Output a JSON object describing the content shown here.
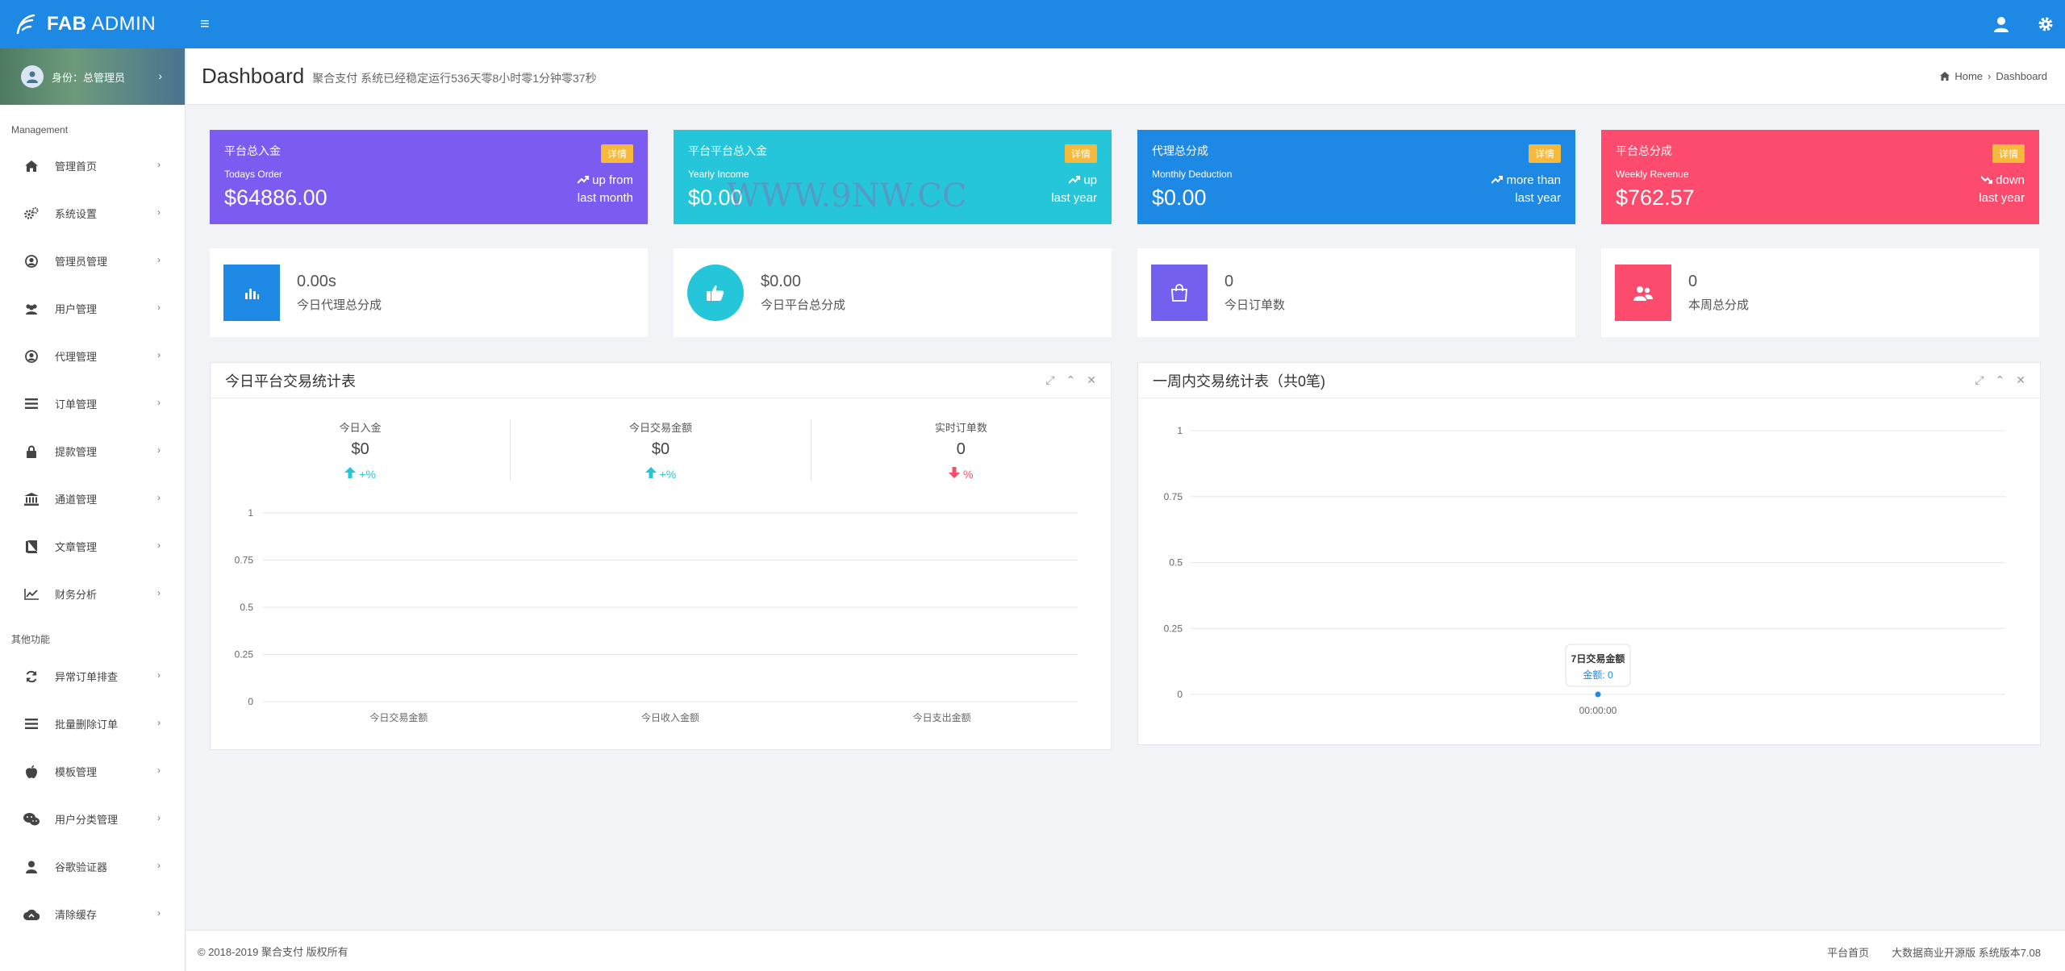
{
  "brand": {
    "name_bold": "FAB",
    "name_rest": " ADMIN"
  },
  "profile": {
    "label": "身份：总管理员"
  },
  "sidebar": {
    "section1": "Management",
    "section2": "其他功能",
    "items1": [
      {
        "label": "管理首页",
        "icon": "home-icon"
      },
      {
        "label": "系统设置",
        "icon": "gears-icon"
      },
      {
        "label": "管理员管理",
        "icon": "user-circle-icon"
      },
      {
        "label": "用户管理",
        "icon": "users-icon"
      },
      {
        "label": "代理管理",
        "icon": "user-circle-icon"
      },
      {
        "label": "订单管理",
        "icon": "list-icon"
      },
      {
        "label": "提款管理",
        "icon": "lock-icon"
      },
      {
        "label": "通道管理",
        "icon": "bank-icon"
      },
      {
        "label": "文章管理",
        "icon": "book-icon"
      },
      {
        "label": "财务分析",
        "icon": "line-chart-icon"
      }
    ],
    "items2": [
      {
        "label": "异常订单排查",
        "icon": "refresh-icon"
      },
      {
        "label": "批量删除订单",
        "icon": "list-icon"
      },
      {
        "label": "模板管理",
        "icon": "apple-icon"
      },
      {
        "label": "用户分类管理",
        "icon": "wechat-icon"
      },
      {
        "label": "谷歌验证器",
        "icon": "user-icon"
      },
      {
        "label": "清除缓存",
        "icon": "cloud-icon"
      }
    ]
  },
  "header": {
    "title": "Dashboard",
    "subtitle": "聚合支付 系统已经稳定运行536天零8小时零1分钟零37秒",
    "breadcrumb_home": "Home",
    "breadcrumb_current": "Dashboard"
  },
  "stat_cards": [
    {
      "title": "平台总入金",
      "sub": "Todays Order",
      "value": "$64886.00",
      "badge": "详情",
      "trend1": "up from",
      "trend2": "last month",
      "color": "#7c5cf0"
    },
    {
      "title": "平台平台总入金",
      "sub": "Yearly Income",
      "value": "$0.00",
      "badge": "详情",
      "trend1": "up",
      "trend2": "last year",
      "color": "#26c6da"
    },
    {
      "title": "代理总分成",
      "sub": "Monthly Deduction",
      "value": "$0.00",
      "badge": "详情",
      "trend1": "more than",
      "trend2": "last year",
      "color": "#1e88e5"
    },
    {
      "title": "平台总分成",
      "sub": "Weekly Revenue",
      "value": "$762.57",
      "badge": "详情",
      "trend1": "down",
      "trend2": "last year",
      "color": "#fc4b6c"
    }
  ],
  "info_boxes": [
    {
      "value": "0.00s",
      "label": "今日代理总分成",
      "color": "#1e88e5",
      "icon": "bar-chart-icon"
    },
    {
      "value": "$0.00",
      "label": "今日平台总分成",
      "color": "#26c6da",
      "icon": "thumbs-up-icon"
    },
    {
      "value": "0",
      "label": "今日订单数",
      "color": "#7460ee",
      "icon": "shopping-bag-icon"
    },
    {
      "value": "0",
      "label": "本周总分成",
      "color": "#fc4b6c",
      "icon": "users-icon"
    }
  ],
  "panel_today": {
    "title": "今日平台交易统计表",
    "kpis": [
      {
        "label": "今日入金",
        "value": "$0",
        "change": "+%",
        "dir": "up"
      },
      {
        "label": "今日交易金额",
        "value": "$0",
        "change": "+%",
        "dir": "up"
      },
      {
        "label": "实时订单数",
        "value": "0",
        "change": "%",
        "dir": "down"
      }
    ]
  },
  "panel_week": {
    "title": "一周内交易统计表（共0笔)"
  },
  "chart_data": [
    {
      "type": "bar",
      "categories": [
        "今日交易金额",
        "今日收入金额",
        "今日支出金额"
      ],
      "values": [
        0,
        0,
        0
      ],
      "yticks": [
        "0",
        "0.25",
        "0.5",
        "0.75",
        "1"
      ],
      "ylim": [
        0,
        1
      ]
    },
    {
      "type": "line",
      "x": [
        "00:00:00"
      ],
      "series": [
        {
          "name": "7日交易金额",
          "values": [
            0
          ]
        }
      ],
      "tooltip_title": "7日交易金额",
      "tooltip_text": "金额: 0",
      "yticks": [
        "0",
        "0.25",
        "0.5",
        "0.75",
        "1"
      ],
      "ylim": [
        0,
        1
      ]
    }
  ],
  "watermark": "WWW.9NW.CC",
  "footer": {
    "copyright": "© 2018-2019 聚合支付 版权所有",
    "link1": "平台首页",
    "link2": "大数据商业开源版 系统版本7.08"
  }
}
